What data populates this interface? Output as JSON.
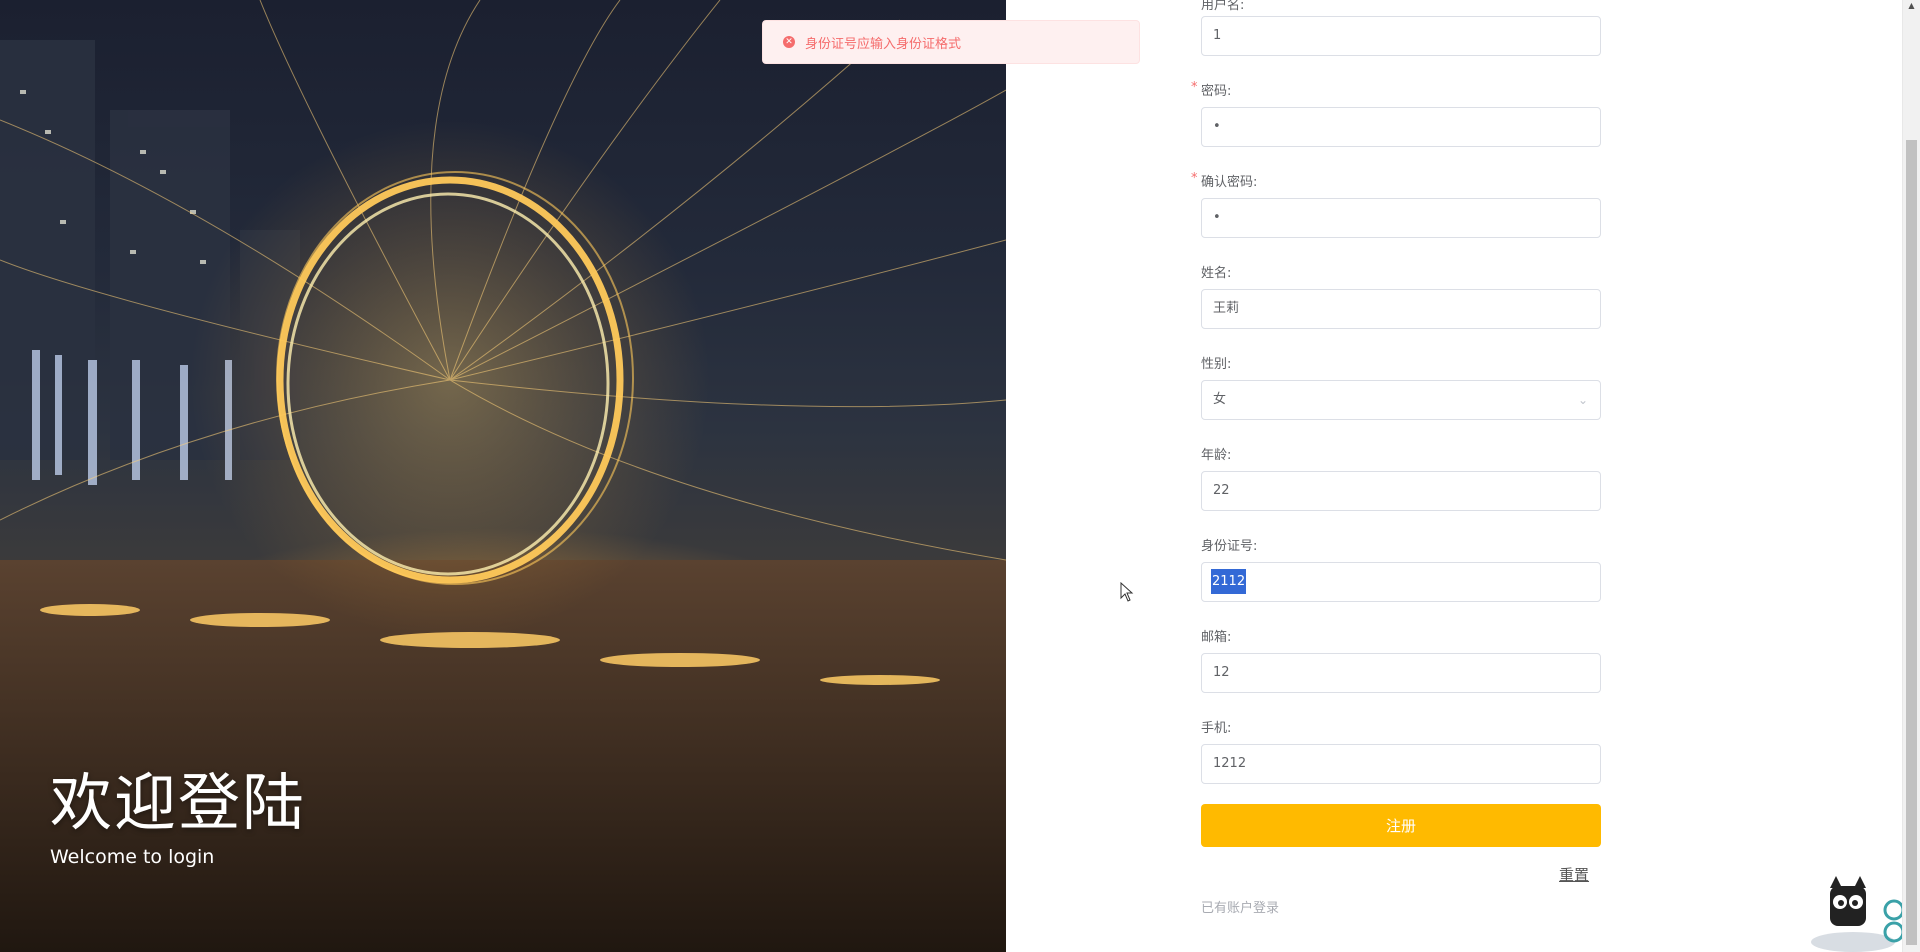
{
  "hero": {
    "title": "欢迎登陆",
    "subtitle": "Welcome to login"
  },
  "toast": {
    "message": "身份证号应输入身份证格式",
    "icon": "error-circle-icon",
    "color": "#f56c6c"
  },
  "form": {
    "username": {
      "label": "用户名:",
      "value": "1",
      "required": true
    },
    "password": {
      "label": "密码:",
      "value": "•",
      "required": true
    },
    "confirm_password": {
      "label": "确认密码:",
      "value": "•",
      "required": true
    },
    "name": {
      "label": "姓名:",
      "value": "王莉"
    },
    "gender": {
      "label": "性别:",
      "value": "女",
      "icon": "chevron-down-icon"
    },
    "age": {
      "label": "年龄:",
      "value": "22"
    },
    "id_number": {
      "label": "身份证号:",
      "value": "2112"
    },
    "email": {
      "label": "邮箱:",
      "value": "12"
    },
    "phone": {
      "label": "手机:",
      "value": "1212"
    },
    "required_mark": "*",
    "submit_label": "注册",
    "reset_label": "重置",
    "login_link": "已有账户登录"
  },
  "colors": {
    "accent": "#ffba00",
    "error": "#f56c6c",
    "selection": "#3369d6",
    "border": "#dcdfe6"
  }
}
